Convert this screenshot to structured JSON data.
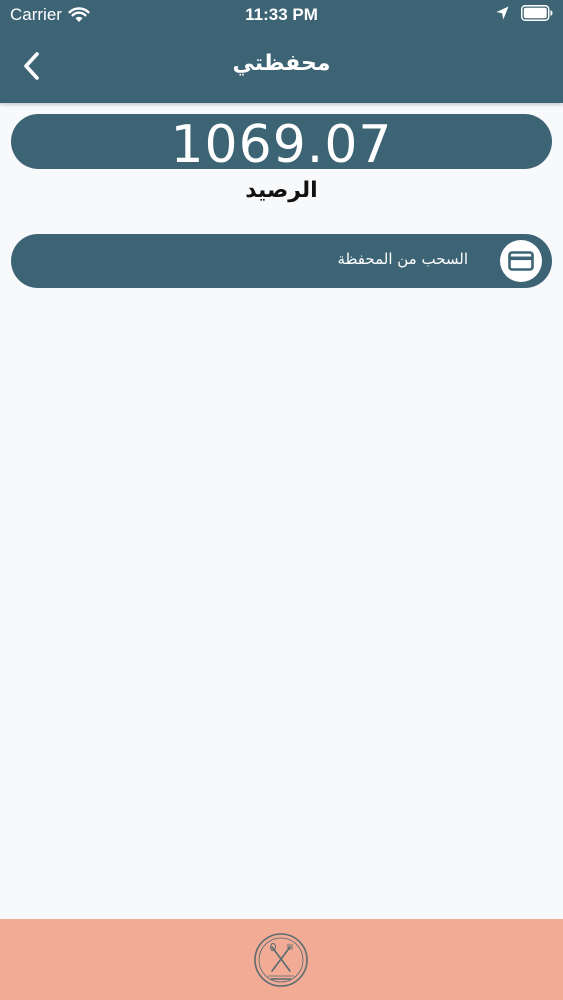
{
  "status_bar": {
    "carrier": "Carrier",
    "time": "11:33 PM"
  },
  "nav": {
    "title": "محفظتي",
    "back_icon": "chevron-left-icon"
  },
  "wallet": {
    "balance": "1069.07",
    "balance_label": "الرصيد",
    "withdraw_label": "السحب من المحفظة",
    "withdraw_icon": "credit-card-icon"
  },
  "footer": {
    "logo_icon": "home-made-logo"
  },
  "colors": {
    "primary": "#3d6474",
    "footer": "#f2ac95",
    "background": "#f8f9fb"
  }
}
